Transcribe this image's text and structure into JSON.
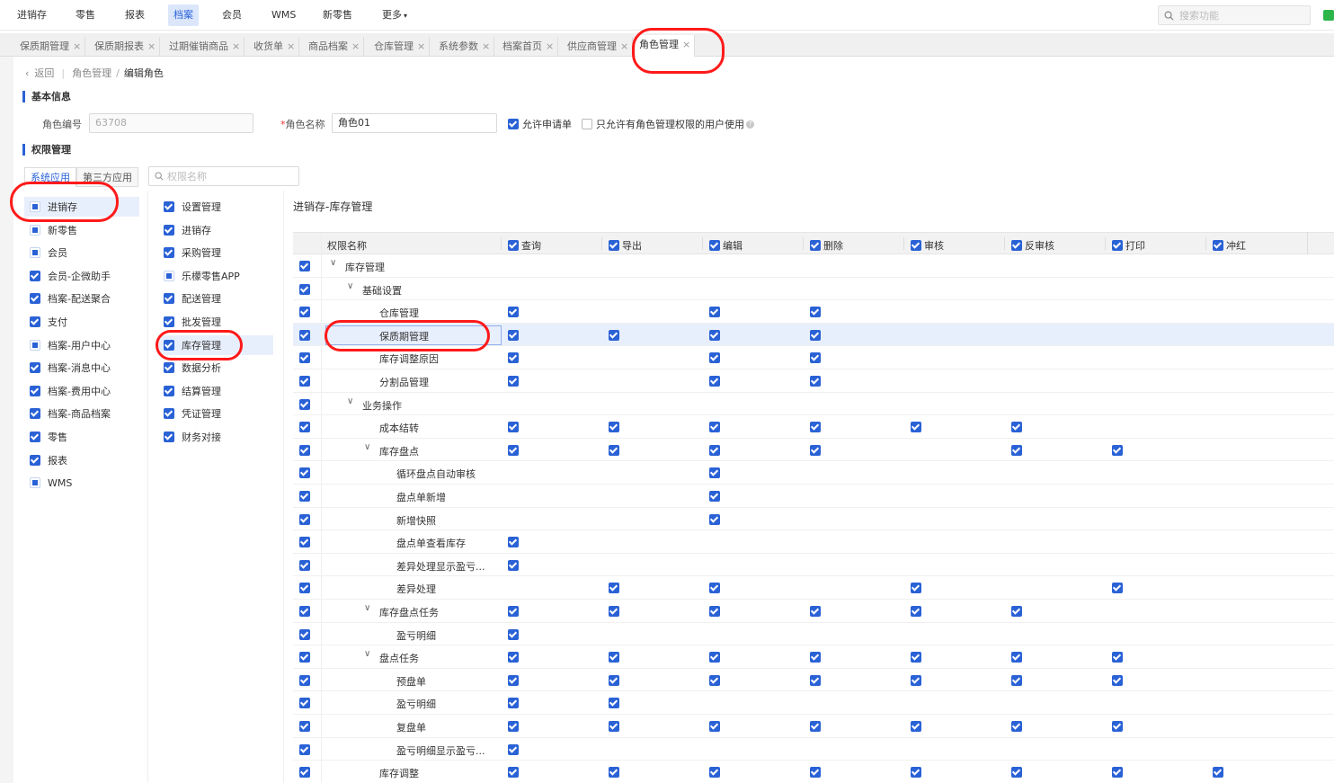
{
  "topnav": {
    "items": [
      "进销存",
      "零售",
      "报表",
      "档案",
      "会员",
      "WMS",
      "新零售",
      "更多"
    ],
    "active_index": 3,
    "more_caret": "▾",
    "search_placeholder": "搜索功能"
  },
  "tabs": [
    {
      "label": "保质期管理",
      "close": "×"
    },
    {
      "label": "保质期报表",
      "close": "×"
    },
    {
      "label": "过期催销商品",
      "close": "×"
    },
    {
      "label": "收货单",
      "close": "×"
    },
    {
      "label": "商品档案",
      "close": "×"
    },
    {
      "label": "仓库管理",
      "close": "×"
    },
    {
      "label": "系统参数",
      "close": "×"
    },
    {
      "label": "档案首页",
      "close": "×"
    },
    {
      "label": "供应商管理",
      "close": "×"
    },
    {
      "label": "角色管理",
      "close": "×",
      "active": true
    }
  ],
  "breadcrumb": {
    "back": "返回",
    "parent": "角色管理",
    "separator": "/",
    "current": "编辑角色"
  },
  "basic_info": {
    "section_title": "基本信息",
    "role_code_label": "角色编号",
    "role_code_value": "63708",
    "role_name_required": "*",
    "role_name_label": "角色名称",
    "role_name_value": "角色01",
    "allow_apply_label": "允许申请单",
    "allow_apply_checked": true,
    "only_admin_label": "只允许有角色管理权限的用户使用",
    "only_admin_checked": false,
    "help_icon": "?"
  },
  "permission": {
    "section_title": "权限管理",
    "app_tabs": [
      "系统应用",
      "第三方应用"
    ],
    "active_app_tab": 0,
    "search_placeholder": "权限名称",
    "modules": [
      {
        "label": "进销存",
        "state": "partial",
        "selected": true
      },
      {
        "label": "新零售",
        "state": "partial"
      },
      {
        "label": "会员",
        "state": "partial"
      },
      {
        "label": "会员-企微助手",
        "state": "checked"
      },
      {
        "label": "档案-配送聚合",
        "state": "checked"
      },
      {
        "label": "支付",
        "state": "checked"
      },
      {
        "label": "档案-用户中心",
        "state": "partial"
      },
      {
        "label": "档案-消息中心",
        "state": "checked"
      },
      {
        "label": "档案-费用中心",
        "state": "checked"
      },
      {
        "label": "档案-商品档案",
        "state": "checked"
      },
      {
        "label": "零售",
        "state": "checked"
      },
      {
        "label": "报表",
        "state": "checked"
      },
      {
        "label": "WMS",
        "state": "partial"
      }
    ],
    "submodules": [
      {
        "label": "设置管理",
        "state": "checked"
      },
      {
        "label": "进销存",
        "state": "checked"
      },
      {
        "label": "采购管理",
        "state": "checked"
      },
      {
        "label": "乐檬零售APP",
        "state": "partial"
      },
      {
        "label": "配送管理",
        "state": "checked"
      },
      {
        "label": "批发管理",
        "state": "checked"
      },
      {
        "label": "库存管理",
        "state": "checked",
        "selected": true
      },
      {
        "label": "数据分析",
        "state": "checked"
      },
      {
        "label": "结算管理",
        "state": "checked"
      },
      {
        "label": "凭证管理",
        "state": "checked"
      },
      {
        "label": "财务对接",
        "state": "checked"
      }
    ],
    "panel_title": "进销存-库存管理",
    "grid_header": {
      "name_col": "权限名称",
      "columns": [
        "查询",
        "导出",
        "编辑",
        "删除",
        "审核",
        "反审核",
        "打印",
        "冲红"
      ]
    },
    "rows": [
      {
        "name": "库存管理",
        "level": 0,
        "expand": "∨",
        "perms": [
          0,
          0,
          0,
          0,
          0,
          0,
          0,
          0
        ]
      },
      {
        "name": "基础设置",
        "level": 1,
        "expand": "∨",
        "perms": [
          0,
          0,
          0,
          0,
          0,
          0,
          0,
          0
        ]
      },
      {
        "name": "仓库管理",
        "level": 2,
        "perms": [
          1,
          0,
          1,
          1,
          0,
          0,
          0,
          0
        ]
      },
      {
        "name": "保质期管理",
        "level": 2,
        "perms": [
          1,
          1,
          1,
          1,
          0,
          0,
          0,
          0
        ],
        "highlight": true
      },
      {
        "name": "库存调整原因",
        "level": 2,
        "perms": [
          1,
          0,
          1,
          1,
          0,
          0,
          0,
          0
        ]
      },
      {
        "name": "分割品管理",
        "level": 2,
        "perms": [
          1,
          0,
          1,
          1,
          0,
          0,
          0,
          0
        ]
      },
      {
        "name": "业务操作",
        "level": 1,
        "expand": "∨",
        "perms": [
          0,
          0,
          0,
          0,
          0,
          0,
          0,
          0
        ]
      },
      {
        "name": "成本结转",
        "level": 2,
        "perms": [
          1,
          1,
          1,
          1,
          1,
          1,
          0,
          0
        ]
      },
      {
        "name": "库存盘点",
        "level": 2,
        "expand": "∨",
        "perms": [
          1,
          1,
          1,
          1,
          0,
          1,
          1,
          0
        ]
      },
      {
        "name": "循环盘点自动审核",
        "level": 3,
        "perms": [
          0,
          0,
          1,
          0,
          0,
          0,
          0,
          0
        ]
      },
      {
        "name": "盘点单新增",
        "level": 3,
        "perms": [
          0,
          0,
          1,
          0,
          0,
          0,
          0,
          0
        ]
      },
      {
        "name": "新增快照",
        "level": 3,
        "perms": [
          0,
          0,
          1,
          0,
          0,
          0,
          0,
          0
        ]
      },
      {
        "name": "盘点单查看库存",
        "level": 3,
        "perms": [
          1,
          0,
          0,
          0,
          0,
          0,
          0,
          0
        ]
      },
      {
        "name": "差异处理显示盈亏...",
        "level": 3,
        "perms": [
          1,
          0,
          0,
          0,
          0,
          0,
          0,
          0
        ]
      },
      {
        "name": "差异处理",
        "level": 3,
        "perms": [
          0,
          1,
          1,
          0,
          1,
          0,
          1,
          0
        ]
      },
      {
        "name": "库存盘点任务",
        "level": 2,
        "expand": "∨",
        "perms": [
          1,
          1,
          1,
          1,
          1,
          1,
          0,
          0
        ]
      },
      {
        "name": "盈亏明细",
        "level": 3,
        "perms": [
          1,
          0,
          0,
          0,
          0,
          0,
          0,
          0
        ]
      },
      {
        "name": "盘点任务",
        "level": 2,
        "expand": "∨",
        "perms": [
          1,
          1,
          1,
          1,
          1,
          1,
          1,
          0
        ]
      },
      {
        "name": "预盘单",
        "level": 3,
        "perms": [
          1,
          1,
          1,
          1,
          1,
          1,
          1,
          0
        ]
      },
      {
        "name": "盈亏明细",
        "level": 3,
        "perms": [
          1,
          1,
          0,
          0,
          0,
          0,
          0,
          0
        ]
      },
      {
        "name": "复盘单",
        "level": 3,
        "perms": [
          1,
          1,
          1,
          1,
          1,
          1,
          1,
          0
        ]
      },
      {
        "name": "盈亏明细显示盈亏...",
        "level": 3,
        "perms": [
          1,
          0,
          0,
          0,
          0,
          0,
          0,
          0
        ]
      },
      {
        "name": "库存调整",
        "level": 2,
        "perms": [
          1,
          1,
          1,
          1,
          1,
          1,
          1,
          1
        ]
      }
    ]
  },
  "colors": {
    "accent": "#2a62d6",
    "highlight": "#e8effc",
    "annotation": "#ff1a1a"
  }
}
